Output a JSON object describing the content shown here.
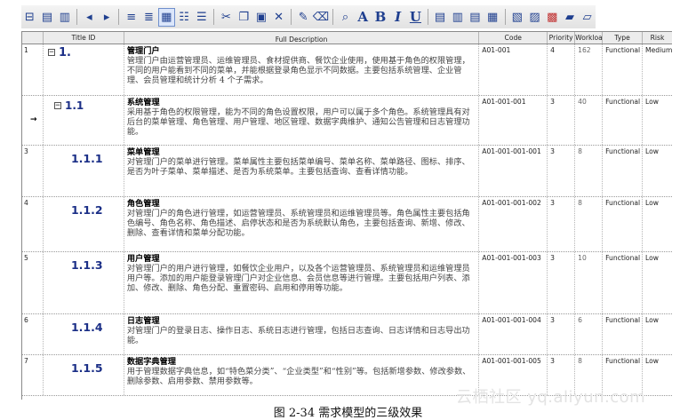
{
  "toolbar": {
    "buttons": [
      {
        "icon": "properties-icon",
        "glyph": "⊟"
      },
      {
        "icon": "insert-row-above-icon",
        "glyph": "▤"
      },
      {
        "icon": "insert-row-below-icon",
        "glyph": "▥"
      },
      {
        "sep": true
      },
      {
        "icon": "arrow-left-icon",
        "glyph": "◂"
      },
      {
        "icon": "arrow-right-icon",
        "glyph": "▸"
      },
      {
        "sep": true
      },
      {
        "icon": "outdent-icon",
        "glyph": "≡"
      },
      {
        "icon": "indent-icon",
        "glyph": "≣"
      },
      {
        "icon": "view-mode-icon",
        "glyph": "▦",
        "selected": true
      },
      {
        "icon": "numbered-list-icon",
        "glyph": "☷"
      },
      {
        "icon": "bulleted-list-icon",
        "glyph": "☰"
      },
      {
        "sep": true
      },
      {
        "icon": "cut-icon",
        "glyph": "✂"
      },
      {
        "icon": "copy-icon",
        "glyph": "❐"
      },
      {
        "icon": "paste-icon",
        "glyph": "▣"
      },
      {
        "icon": "delete-icon",
        "glyph": "✕"
      },
      {
        "sep": true
      },
      {
        "icon": "format-painter-icon",
        "glyph": "✎"
      },
      {
        "icon": "clear-format-icon",
        "glyph": "⌫"
      },
      {
        "sep": true
      },
      {
        "icon": "find-icon",
        "glyph": "⌕"
      },
      {
        "icon": "font-color-icon",
        "glyph": "A",
        "text": true
      },
      {
        "icon": "bold-icon",
        "glyph": "B",
        "text": true
      },
      {
        "icon": "italic-icon",
        "glyph": "I",
        "text": true
      },
      {
        "icon": "underline-icon",
        "glyph": "U",
        "text": true
      },
      {
        "sep": true
      },
      {
        "icon": "align-left-icon",
        "glyph": "▤"
      },
      {
        "icon": "align-center-icon",
        "glyph": "▥"
      },
      {
        "icon": "align-right-icon",
        "glyph": "▤"
      },
      {
        "icon": "justify-icon",
        "glyph": "▦"
      },
      {
        "sep": true
      },
      {
        "icon": "document-icon",
        "glyph": "▧"
      },
      {
        "icon": "image-icon",
        "glyph": "▨"
      },
      {
        "icon": "chart-icon",
        "glyph": "▩",
        "red": true
      },
      {
        "icon": "folder-icon",
        "glyph": "▰"
      },
      {
        "icon": "open-folder-icon",
        "glyph": "▱"
      }
    ]
  },
  "columns": [
    {
      "key": "num",
      "label": ""
    },
    {
      "key": "title",
      "label": "Title ID"
    },
    {
      "key": "desc",
      "label": "Full Description"
    },
    {
      "key": "code",
      "label": "Code"
    },
    {
      "key": "priority",
      "label": "Priority"
    },
    {
      "key": "workload",
      "label": "Workloa"
    },
    {
      "key": "type",
      "label": "Type"
    },
    {
      "key": "risk",
      "label": "Risk"
    }
  ],
  "rows": [
    {
      "num": "1",
      "current": false,
      "level": 1,
      "collapsible": true,
      "title_id": "1.",
      "desc_title": "管理门户",
      "desc_body": "管理门户由运营管理员、运维管理员、食材提供商、餐饮企业使用，使用基于角色的权限管理，不同的用户能看到不同的菜单，并能根据登录角色显示不同数据。主要包括系统管理、企业管理、会员管理和统计分析 4 个子需求。",
      "code": "A01-001",
      "priority": "4",
      "workload": "162",
      "type": "Functional",
      "risk": "Medium"
    },
    {
      "num": "",
      "current": true,
      "level": 2,
      "collapsible": true,
      "title_id": "1.1",
      "desc_title": "系统管理",
      "desc_body": "采用基于角色的权限管理，能为不同的角色设置权限，用户可以属于多个角色。系统管理具有对后台的菜单管理、角色管理、用户管理、地区管理、数据字典维护、通知公告管理和日志管理功能。",
      "code": "A01-001-001",
      "priority": "3",
      "workload": "40",
      "type": "Functional",
      "risk": "Low"
    },
    {
      "num": "3",
      "current": false,
      "level": 3,
      "collapsible": false,
      "title_id": "1.1.1",
      "desc_title": "菜单管理",
      "desc_body": "对管理门户的菜单进行管理。菜单属性主要包括菜单编号、菜单名称、菜单路径、图标、排序、是否为叶子菜单、菜单描述、是否为系统菜单。主要包括查询、查看详情功能。",
      "code": "A01-001-001-001",
      "priority": "3",
      "workload": "8",
      "type": "Functional",
      "risk": "Low"
    },
    {
      "num": "4",
      "current": false,
      "level": 3,
      "collapsible": false,
      "title_id": "1.1.2",
      "desc_title": "角色管理",
      "desc_body": "对管理门户的角色进行管理，如运营管理员、系统管理员和运维管理员等。角色属性主要包括角色编号、角色名称、角色描述、启停状态和是否为系统默认角色，主要包括查询、新增、修改、删除、查看详情和菜单分配功能。",
      "code": "A01-001-001-002",
      "priority": "3",
      "workload": "8",
      "type": "Functional",
      "risk": "Low"
    },
    {
      "num": "5",
      "current": false,
      "level": 3,
      "collapsible": false,
      "title_id": "1.1.3",
      "desc_title": "用户管理",
      "desc_body": "对管理门户的用户进行管理，如餐饮企业用户，以及各个运营管理员、系统管理员和运维管理员用户等。添加的用户能登录管理门户对企业信息、会员信息等进行管理。主要包括用户列表、添加、修改、删除、角色分配、重置密码、启用和停用等功能。",
      "code": "A01-001-001-003",
      "priority": "3",
      "workload": "10",
      "type": "Functional",
      "risk": "Low"
    },
    {
      "num": "6",
      "current": false,
      "level": 3,
      "collapsible": false,
      "title_id": "1.1.4",
      "desc_title": "日志管理",
      "desc_body": "对管理门户的登录日志、操作日志、系统日志进行管理，包括日志查询、日志详情和日志导出功能。",
      "code": "A01-001-001-004",
      "priority": "3",
      "workload": "6",
      "type": "Functional",
      "risk": "Low"
    },
    {
      "num": "7",
      "current": false,
      "level": 3,
      "collapsible": false,
      "title_id": "1.1.5",
      "desc_title": "数据字典管理",
      "desc_body": "用于管理数据字典信息，如“特色菜分类”、“企业类型”和“性别”等。包括新增参数、修改参数、删除参数、启用参数、禁用参数等。",
      "code": "A01-001-001-005",
      "priority": "3",
      "workload": "8",
      "type": "Functional",
      "risk": "Low"
    }
  ],
  "watermark": "云栖社区 yq.aliyun.com",
  "caption": "图 2-34   需求模型的三级效果"
}
